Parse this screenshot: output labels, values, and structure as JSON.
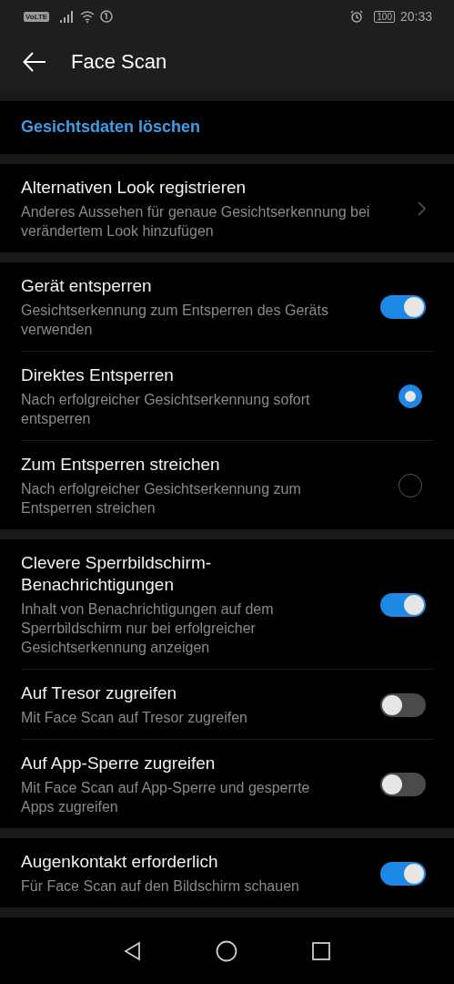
{
  "status_bar": {
    "network_badge": "VoLTE",
    "battery": "100",
    "time": "20:33"
  },
  "header": {
    "title": "Face Scan"
  },
  "groups": [
    {
      "items": [
        {
          "kind": "link",
          "title": "Gesichtsdaten löschen"
        }
      ]
    },
    {
      "items": [
        {
          "kind": "nav",
          "title": "Alternativen Look registrieren",
          "subtitle": "Anderes Aussehen für genaue Gesichtserkennung bei verändertem Look hinzufügen"
        }
      ]
    },
    {
      "items": [
        {
          "kind": "toggle",
          "title": "Gerät entsperren",
          "subtitle": "Gesichtserkennung zum Entsperren des Geräts verwenden",
          "on": true
        },
        {
          "kind": "radio",
          "title": "Direktes Entsperren",
          "subtitle": "Nach erfolgreicher Gesichtserkennung sofort entsperren",
          "selected": true
        },
        {
          "kind": "radio",
          "title": "Zum Entsperren streichen",
          "subtitle": "Nach erfolgreicher Gesichtserkennung zum Entsperren streichen",
          "selected": false
        }
      ]
    },
    {
      "items": [
        {
          "kind": "toggle",
          "title": "Clevere Sperrbildschirm-Benachrichtigungen",
          "subtitle": "Inhalt von Benachrichtigungen auf dem Sperrbildschirm nur bei erfolgreicher Gesichtserkennung anzeigen",
          "on": true
        },
        {
          "kind": "toggle",
          "title": "Auf Tresor zugreifen",
          "subtitle": "Mit Face Scan auf Tresor zugreifen",
          "on": false
        },
        {
          "kind": "toggle",
          "title": "Auf App-Sperre zugreifen",
          "subtitle": "Mit Face Scan auf App-Sperre und gesperrte Apps zugreifen",
          "on": false
        }
      ]
    },
    {
      "items": [
        {
          "kind": "toggle",
          "title": "Augenkontakt erforderlich",
          "subtitle": "Für Face Scan auf den Bildschirm schauen",
          "on": true
        }
      ]
    }
  ]
}
